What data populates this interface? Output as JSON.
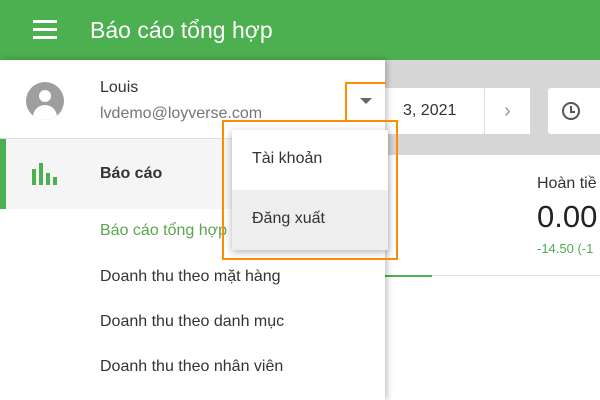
{
  "appbar": {
    "title": "Báo cáo tổng hợp",
    "menu_icon": "hamburger-menu-icon"
  },
  "user": {
    "name": "Louis",
    "email": "lvdemo@loyverse.com"
  },
  "nav": {
    "reports_label": "Báo cáo",
    "sub_items": [
      {
        "label": "Báo cáo tổng hợp",
        "active": true
      },
      {
        "label": "Doanh thu theo mặt hàng",
        "active": false
      },
      {
        "label": "Doanh thu theo danh mục",
        "active": false
      },
      {
        "label": "Doanh thu theo nhân viên",
        "active": false
      }
    ]
  },
  "dropdown": {
    "items": [
      {
        "label": "Tài khoản"
      },
      {
        "label": "Đăng xuất"
      }
    ]
  },
  "date_picker": {
    "date_text": "3, 2021",
    "next_symbol": "›"
  },
  "summary_card": {
    "label": "Hoàn tiề",
    "value": "0.00",
    "delta": "-14.50 (-1"
  },
  "colors": {
    "appbar": "#4caf50",
    "accent": "#4caf50",
    "highlight": "#ff8c00"
  }
}
